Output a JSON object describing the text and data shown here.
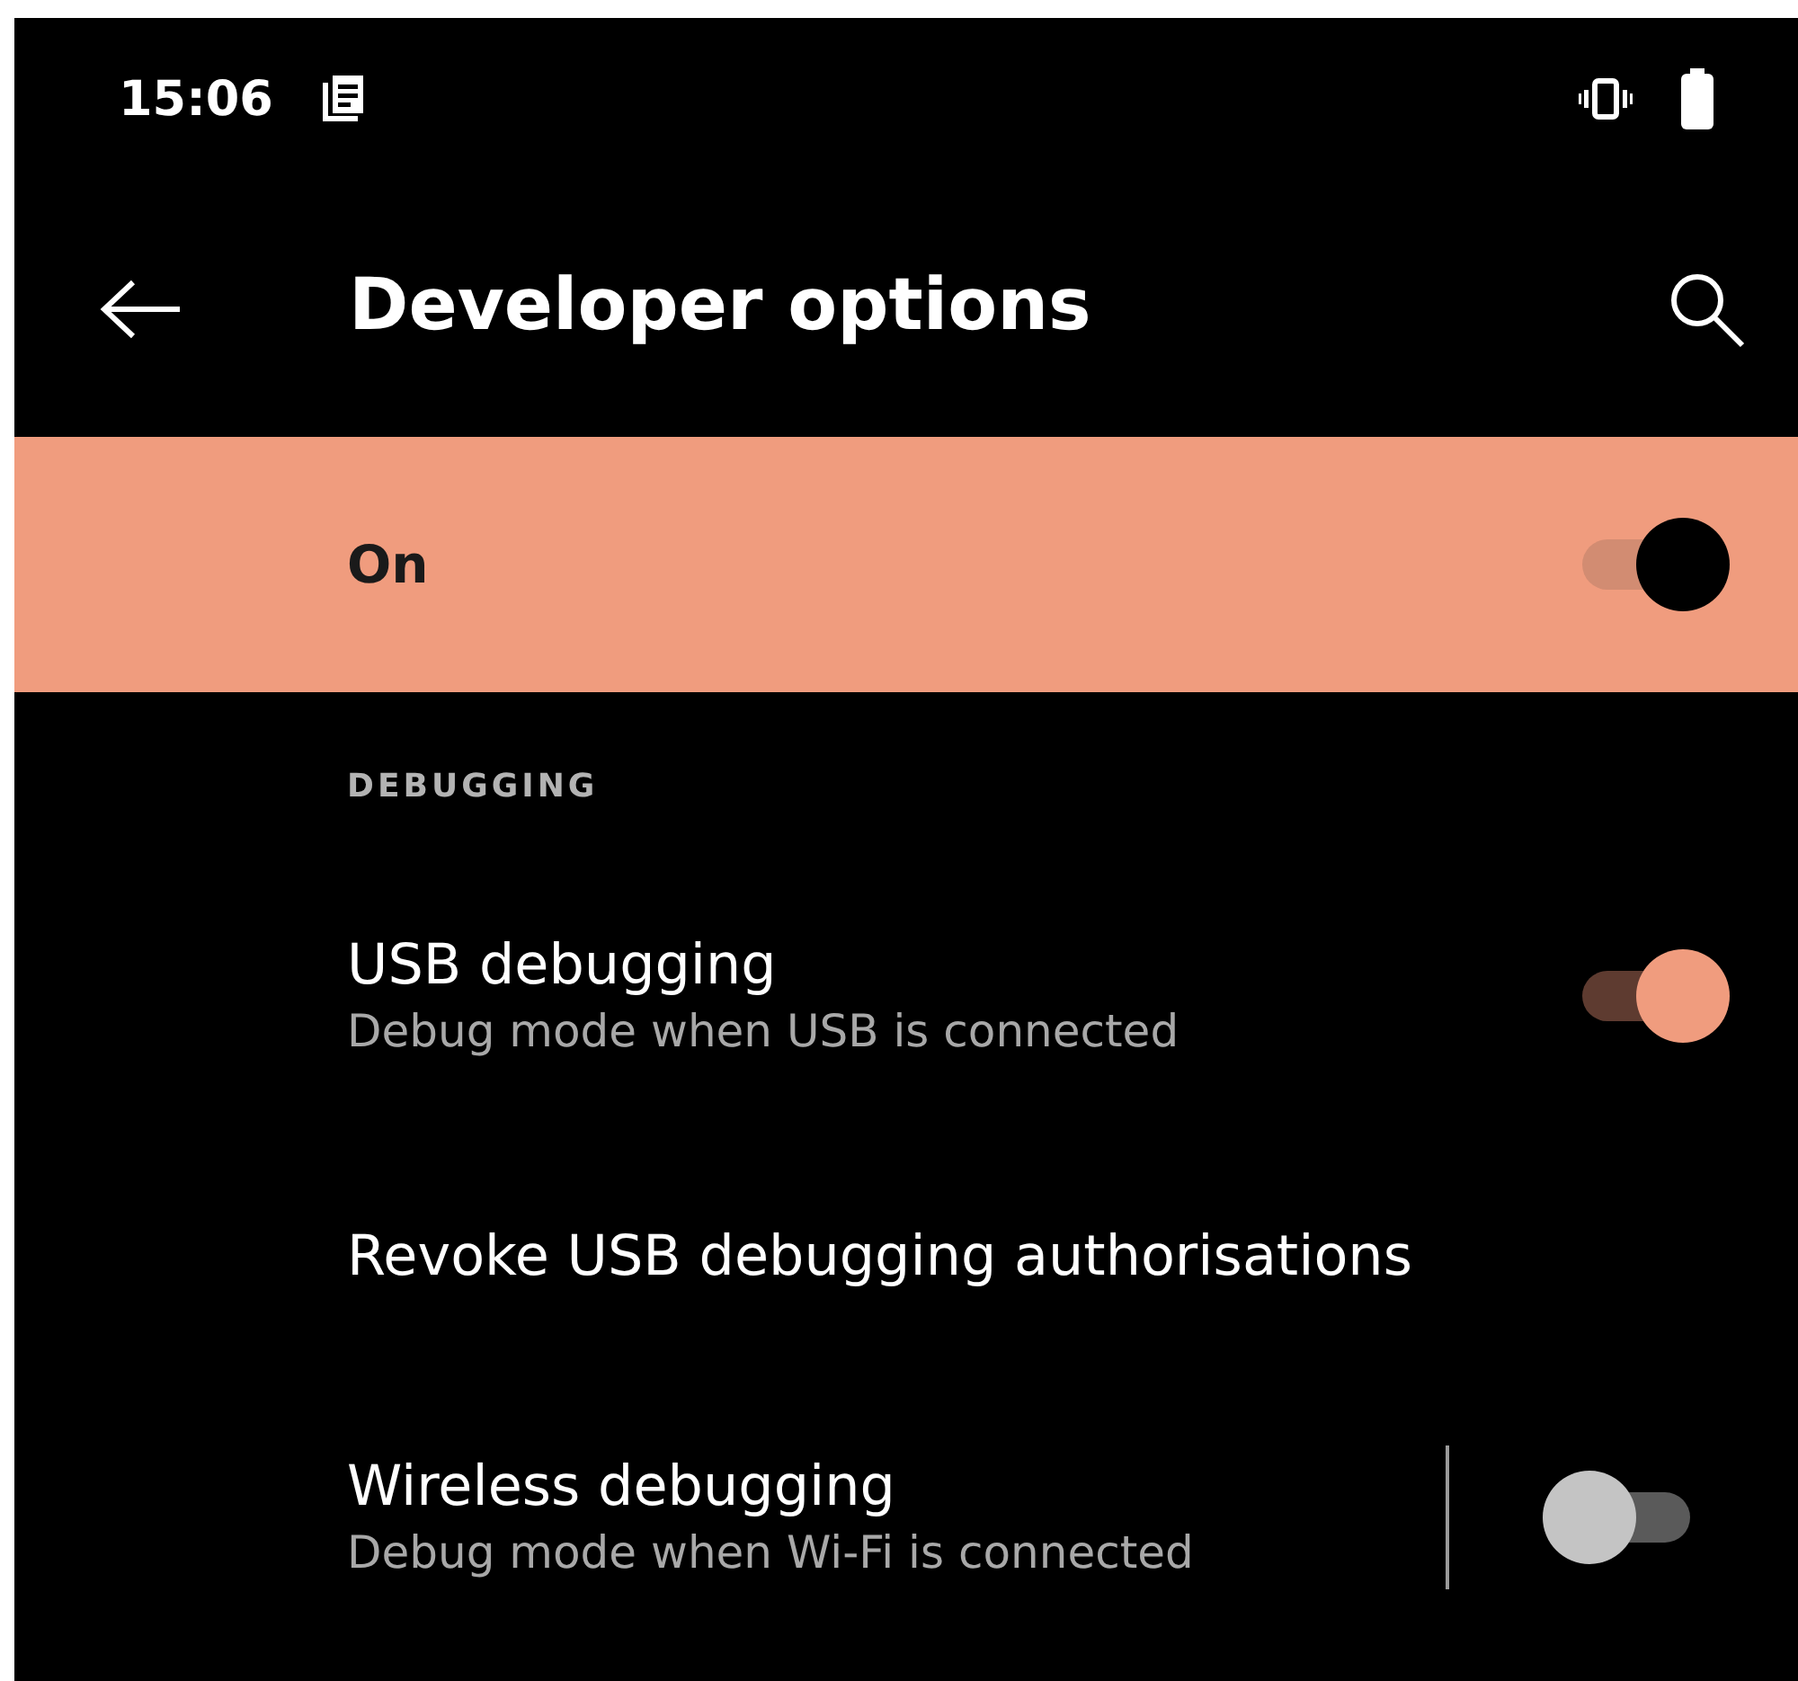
{
  "status_bar": {
    "time": "15:06"
  },
  "app_bar": {
    "title": "Developer options"
  },
  "main_switch": {
    "label": "On",
    "on": true
  },
  "sections": [
    {
      "header": "DEBUGGING",
      "items": [
        {
          "kind": "switch",
          "title": "USB debugging",
          "summary": "Debug mode when USB is connected",
          "on": true
        },
        {
          "kind": "plain",
          "title": "Revoke USB debugging authorisations"
        },
        {
          "kind": "split_switch",
          "title": "Wireless debugging",
          "summary": "Debug mode when Wi-Fi is connected",
          "on": false
        }
      ]
    }
  ]
}
